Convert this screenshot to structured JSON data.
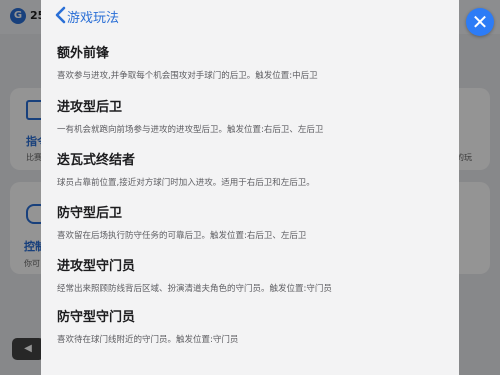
{
  "background": {
    "logo_letter": "G",
    "count_partial": "25",
    "card1_title_partial": "指令",
    "card1_desc_partial": "比赛",
    "card1_right_partial": "的玩",
    "card2_title_partial": "控制",
    "card2_desc_partial": "你可"
  },
  "close_button": {
    "glyph": "✕"
  },
  "header": {
    "title": "游戏玩法"
  },
  "items": [
    {
      "title": "额外前锋",
      "desc": "喜欢参与进攻,并争取每个机会围攻对手球门的后卫。触发位置:中后卫"
    },
    {
      "title": "进攻型后卫",
      "desc": "一有机会就跑向前场参与进攻的进攻型后卫。触发位置:右后卫、左后卫"
    },
    {
      "title": "迭瓦式终结者",
      "desc": "球员占靠前位置,接近对方球门时加入进攻。适用于右后卫和左后卫。"
    },
    {
      "title": "防守型后卫",
      "desc": "喜欢留在后场执行防守任务的可靠后卫。触发位置:右后卫、左后卫"
    },
    {
      "title": "进攻型守门员",
      "desc": "经常出来照顾防线背后区域、扮演清道夫角色的守门员。触发位置:守门员"
    },
    {
      "title": "防守型守门员",
      "desc": "喜欢待在球门线附近的守门员。触发位置:守门员"
    }
  ],
  "colors": {
    "accent": "#2a6fd6",
    "close": "#2d7cf6",
    "panel": "#f3f3f4"
  }
}
